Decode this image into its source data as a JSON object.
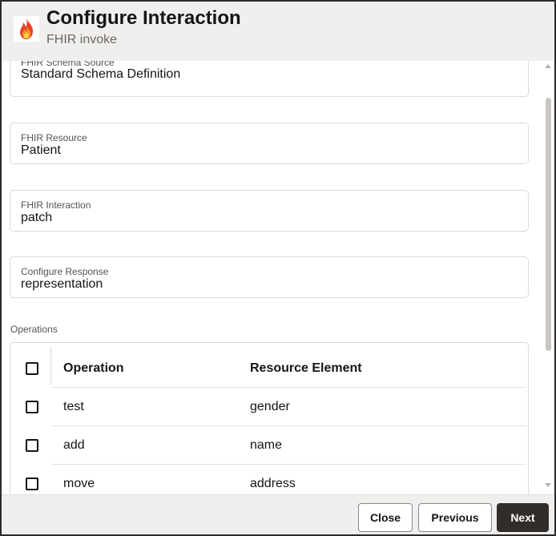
{
  "header": {
    "title": "Configure Interaction",
    "subtitle": "FHIR invoke",
    "logo_icon": "flame-icon"
  },
  "fields": [
    {
      "label": "FHIR Schema Source",
      "value": "Standard Schema Definition"
    },
    {
      "label": "FHIR Resource",
      "value": "Patient"
    },
    {
      "label": "FHIR Interaction",
      "value": "patch"
    },
    {
      "label": "Configure Response",
      "value": "representation"
    }
  ],
  "operations": {
    "label": "Operations",
    "columns": [
      "Operation",
      "Resource Element"
    ],
    "rows": [
      {
        "operation": "test",
        "element": "gender",
        "checked": false
      },
      {
        "operation": "add",
        "element": "name",
        "checked": false
      },
      {
        "operation": "move",
        "element": "address",
        "checked": false
      }
    ]
  },
  "footer": {
    "close_label": "Close",
    "previous_label": "Previous",
    "next_label": "Next"
  },
  "colors": {
    "header_bg": "#f1efed",
    "primary_button": "#312d2a",
    "border": "#dcd9d5"
  }
}
